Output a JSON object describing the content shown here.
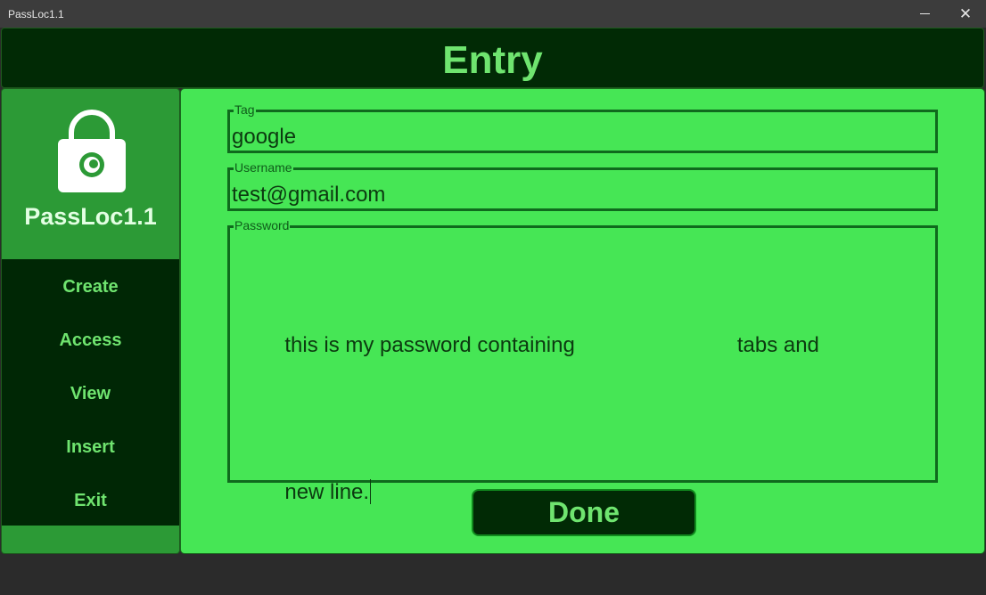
{
  "window": {
    "title": "PassLoc1.1",
    "minimize_icon": "minimize-icon",
    "close_icon": "close-icon",
    "close_glyph": "✕"
  },
  "header": {
    "title": "Entry"
  },
  "sidebar": {
    "brand": {
      "name": "PassLoc1.1",
      "icon": "lock-icon"
    },
    "items": [
      {
        "label": "Create"
      },
      {
        "label": "Access"
      },
      {
        "label": "View"
      },
      {
        "label": "Insert"
      },
      {
        "label": "Exit"
      }
    ]
  },
  "form": {
    "tag": {
      "label": "Tag",
      "value": "google"
    },
    "username": {
      "label": "Username",
      "value": "test@gmail.com"
    },
    "password": {
      "label": "Password",
      "line1_start": "this is my password containing",
      "line1_end": "tabs and",
      "line2": "new line."
    },
    "done_label": "Done"
  },
  "colors": {
    "header_bg": "#012a05",
    "accent_text": "#6fe46f",
    "brand_bg": "#2c9a36",
    "main_bg": "#46e655",
    "field_border": "#0f6a1d"
  }
}
